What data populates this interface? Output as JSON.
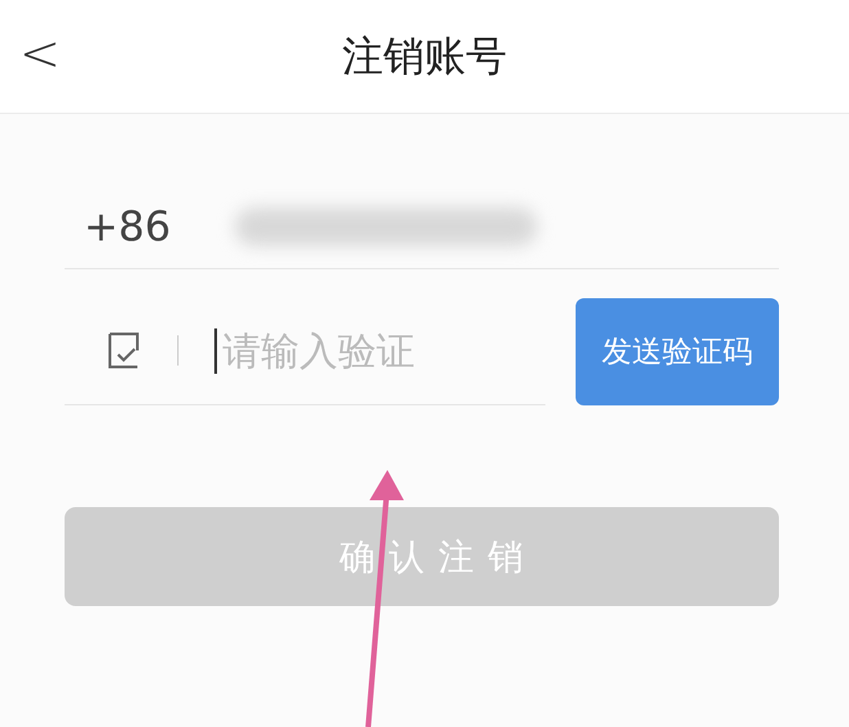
{
  "header": {
    "back": "<",
    "title": "注销账号"
  },
  "phone": {
    "country_code": "+86"
  },
  "code": {
    "placeholder": "请输入验证",
    "send_button": "发送验证码"
  },
  "confirm_button": {
    "label": "确认注销",
    "disabled": true
  }
}
